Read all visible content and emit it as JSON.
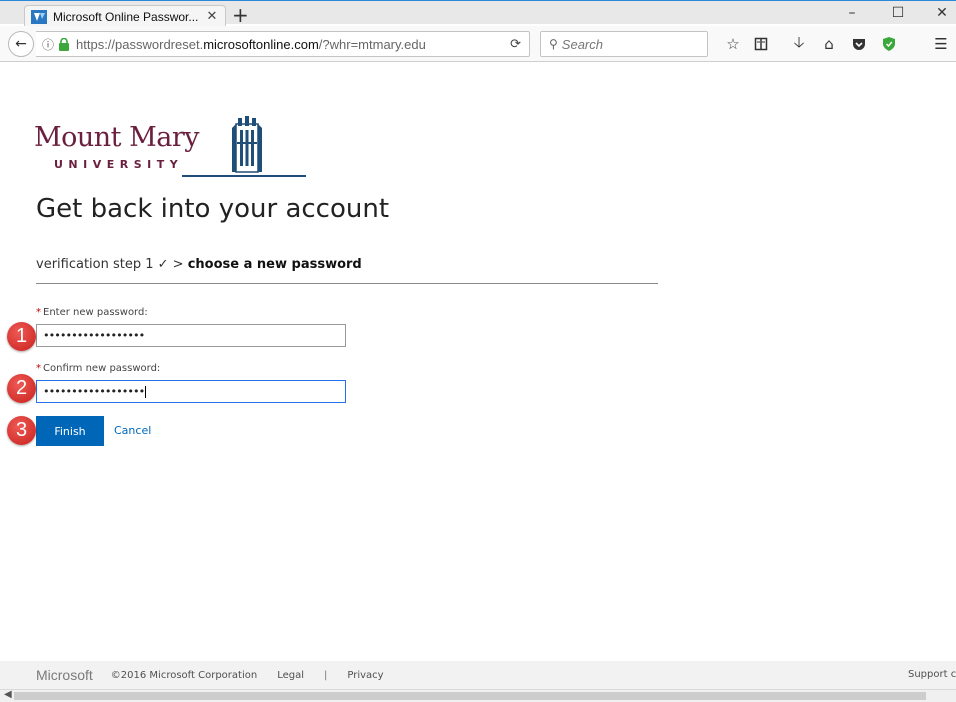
{
  "browser": {
    "tab_title": "Microsoft Online Passwor...",
    "tab_close": "✕",
    "new_tab": "+",
    "window_controls": {
      "minimize": "–",
      "maximize": "☐",
      "close": "✕"
    },
    "url_prefix": "https://passwordreset.",
    "url_domain": "microsoftonline.com",
    "url_suffix": "/?whr=mtmary.edu",
    "search_placeholder": "Search",
    "accent_color": "#2b88d8"
  },
  "logo": {
    "name": "Mount Mary",
    "subtitle": "UNIVERSITY",
    "color": "#6a1f3e"
  },
  "page": {
    "title": "Get back into your account",
    "steps": {
      "completed": "verification step 1 ✓ >",
      "current": "choose a new password"
    }
  },
  "form": {
    "new_password_label": "Enter new password:",
    "new_password_value": "••••••••••••••••••",
    "confirm_password_label": "Confirm new password:",
    "confirm_password_value": "••••••••••••••••••",
    "required_marker": "*",
    "finish_label": "Finish",
    "cancel_label": "Cancel",
    "primary_color": "#0067b8"
  },
  "annotations": [
    "1",
    "2",
    "3"
  ],
  "footer": {
    "brand": "Microsoft",
    "copyright": "©2016 Microsoft Corporation",
    "legal": "Legal",
    "separator": "|",
    "privacy": "Privacy",
    "support": "Support c"
  },
  "icons": {
    "back": "back-arrow-icon",
    "info": "info-icon",
    "lock": "lock-icon",
    "reload": "reload-icon",
    "search": "search-icon",
    "bookmark": "bookmark-star-icon",
    "reader": "reader-view-icon",
    "download": "download-icon",
    "home": "home-icon",
    "pocket": "pocket-icon",
    "shield": "shield-icon",
    "menu": "hamburger-menu-icon"
  }
}
